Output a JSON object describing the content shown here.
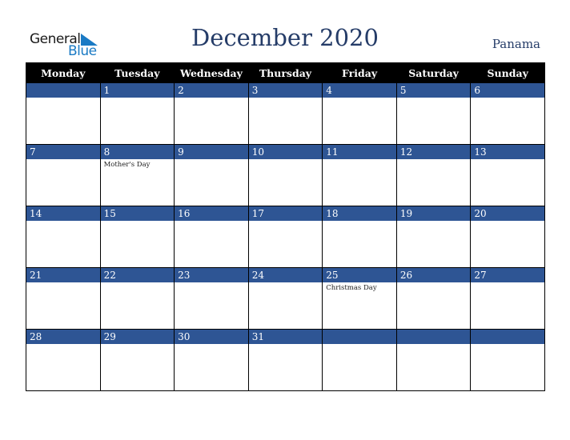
{
  "logo": {
    "line1": "General",
    "line2": "Blue"
  },
  "title": "December 2020",
  "country": "Panama",
  "weekdays": [
    "Monday",
    "Tuesday",
    "Wednesday",
    "Thursday",
    "Friday",
    "Saturday",
    "Sunday"
  ],
  "weeks": [
    [
      {
        "day": "",
        "event": ""
      },
      {
        "day": "1",
        "event": ""
      },
      {
        "day": "2",
        "event": ""
      },
      {
        "day": "3",
        "event": ""
      },
      {
        "day": "4",
        "event": ""
      },
      {
        "day": "5",
        "event": ""
      },
      {
        "day": "6",
        "event": ""
      }
    ],
    [
      {
        "day": "7",
        "event": ""
      },
      {
        "day": "8",
        "event": "Mother's Day"
      },
      {
        "day": "9",
        "event": ""
      },
      {
        "day": "10",
        "event": ""
      },
      {
        "day": "11",
        "event": ""
      },
      {
        "day": "12",
        "event": ""
      },
      {
        "day": "13",
        "event": ""
      }
    ],
    [
      {
        "day": "14",
        "event": ""
      },
      {
        "day": "15",
        "event": ""
      },
      {
        "day": "16",
        "event": ""
      },
      {
        "day": "17",
        "event": ""
      },
      {
        "day": "18",
        "event": ""
      },
      {
        "day": "19",
        "event": ""
      },
      {
        "day": "20",
        "event": ""
      }
    ],
    [
      {
        "day": "21",
        "event": ""
      },
      {
        "day": "22",
        "event": ""
      },
      {
        "day": "23",
        "event": ""
      },
      {
        "day": "24",
        "event": ""
      },
      {
        "day": "25",
        "event": "Christmas Day"
      },
      {
        "day": "26",
        "event": ""
      },
      {
        "day": "27",
        "event": ""
      }
    ],
    [
      {
        "day": "28",
        "event": ""
      },
      {
        "day": "29",
        "event": ""
      },
      {
        "day": "30",
        "event": ""
      },
      {
        "day": "31",
        "event": ""
      },
      {
        "day": "",
        "event": ""
      },
      {
        "day": "",
        "event": ""
      },
      {
        "day": "",
        "event": ""
      }
    ]
  ],
  "colors": {
    "band": "#2e5594",
    "title": "#253c68",
    "logo_blue": "#1a7ac4"
  }
}
